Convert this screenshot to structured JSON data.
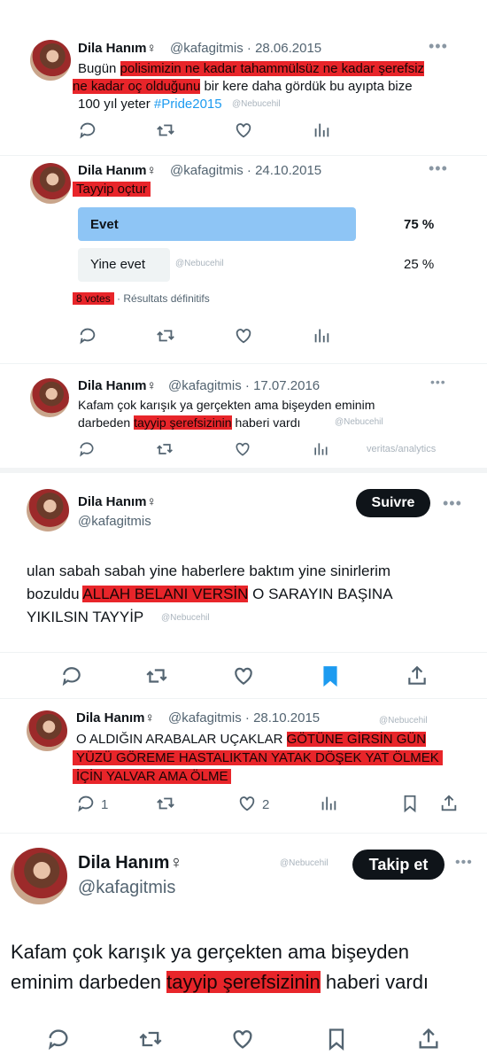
{
  "t1": {
    "name": "Dila Hanım♀",
    "meta": "@kafagitmis · 28.06.2015",
    "l1a": "Bugün ",
    "l1b": "polisimizin ne kadar tahammülsüz ne kadar şerefsiz",
    "l2a": "ne kadar oç olduğunu",
    "l2b": " bir kere daha gördük bu ayıpta bize",
    "l3a": "100 yıl yeter ",
    "l3b": "#Pride2015",
    "wm": "@Nebucehil",
    "more": "•••"
  },
  "t2": {
    "name": "Dila Hanım♀",
    "meta": "@kafagitmis · 24.10.2015",
    "text": "Tayyip oçtur",
    "poll": [
      {
        "label": "Evet",
        "percent": "75 %",
        "value": 75
      },
      {
        "label": "Yine evet",
        "percent": "25 %",
        "value": 25
      }
    ],
    "votes": "8 votes",
    "votes_suffix": " · Résultats définitifs",
    "wm": "@Nebucehil",
    "more": "•••"
  },
  "t3": {
    "name": "Dila Hanım♀",
    "meta": "@kafagitmis · 17.07.2016",
    "l1": "Kafam çok karışık ya gerçekten ama bişeyden eminim",
    "l2a": "darbeden ",
    "l2b": "tayyip şerefsizinin",
    "l2c": " haberi vardı",
    "wm": "@Nebucehil",
    "wm2": "veritas/analytics",
    "more": "•••"
  },
  "t4": {
    "name": "Dila Hanım♀",
    "handle": "@kafagitmis",
    "follow": "Suivre",
    "l1": "ulan sabah sabah yine haberlere baktım yine sinirlerim",
    "l2a": "bozuldu ",
    "l2b": "ALLAH BELANI VERSİN",
    "l2c": " O SARAYIN BAŞINA",
    "l3": "YIKILSIN TAYYİP",
    "wm": "@Nebucehil",
    "more": "•••"
  },
  "t5": {
    "name": "Dila Hanım♀",
    "meta": "@kafagitmis · 28.10.2015",
    "l1a": "O ALDIĞIN ARABALAR UÇAKLAR ",
    "l1b": "GÖTÜNE GİRSİN GÜN",
    "l2": "YÜZÜ GÖREME HASTALIKTAN YATAK DÖŞEK YAT ÖLMEK",
    "l3": "İÇİN YALVAR AMA ÖLME",
    "reply_count": "1",
    "like_count": "2",
    "wm": "@Nebucehil",
    "more": "•••"
  },
  "t6": {
    "name": "Dila Hanım♀",
    "handle": "@kafagitmis",
    "follow": "Takip et",
    "l1": "Kafam çok karışık ya gerçekten ama bişeyden",
    "l2a": "eminim darbeden ",
    "l2b": "tayyip şerefsizinin",
    "l2c": " haberi vardı",
    "wm": "@Nebucehil",
    "more": "•••"
  },
  "colors": {
    "highlight": "#e8252a",
    "poll_win": "#8ec5f5",
    "poll_other": "#eff3f4",
    "bookmark_active": "#1d9bf0"
  }
}
